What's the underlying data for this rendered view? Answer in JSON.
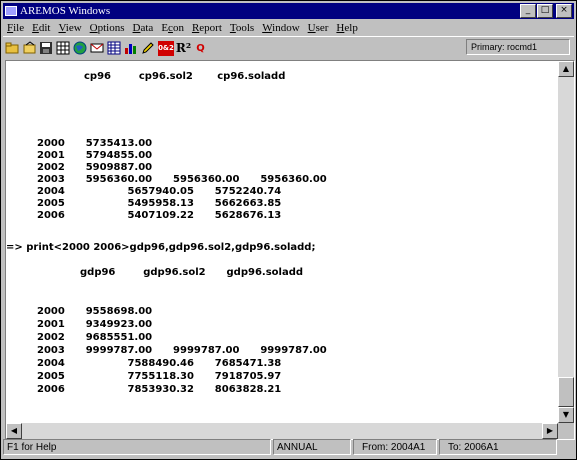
{
  "window": {
    "title": "AREMOS Windows",
    "minimize_glyph": "_",
    "maximize_glyph": "□",
    "close_glyph": "×"
  },
  "menu": [
    "File",
    "Edit",
    "View",
    "Options",
    "Data",
    "Econ",
    "Report",
    "Tools",
    "Window",
    "User",
    "Help"
  ],
  "menu_underlines": [
    "F",
    "E",
    "V",
    "O",
    "D",
    "c",
    "R",
    "T",
    "W",
    "U",
    "H"
  ],
  "toolbar": {
    "tools": [
      "open-folder-icon",
      "open-file-icon",
      "save-icon",
      "table-icon",
      "globe-icon",
      "envelope-icon",
      "grid-icon",
      "bar-chart-icon",
      "pencil-icon",
      "calculator-icon",
      "r-squared-icon",
      "q-icon"
    ],
    "r_squared_label": "R²",
    "q_label": "Q",
    "calc_label": "0&2",
    "primary_label": "Primary: rocmd1"
  },
  "output": {
    "header1": "cp96        cp96.sol2       cp96.soladd",
    "table1": [
      "2000      5735413.00",
      "2001      5794855.00",
      "2002      5909887.00",
      "2003      5956360.00      5956360.00      5956360.00",
      "2004                  5657940.05      5752240.74",
      "2005                  5495958.13      5662663.85",
      "2006                  5407109.22      5628676.13"
    ],
    "command": "=> print<2000 2006>gdp96,gdp96.sol2,gdp96.soladd;",
    "header2": "gdp96        gdp96.sol2      gdp96.soladd",
    "table2": [
      "2000      9558698.00",
      "2001      9349923.00",
      "2002      9685551.00",
      "2003      9999787.00      9999787.00      9999787.00",
      "2004                  7588490.46      7685471.38",
      "2005                  7755118.30      7918705.97",
      "2006                  7853930.32      8063828.21"
    ]
  },
  "status": {
    "help": "F1 for Help",
    "frequency": "ANNUAL",
    "from": "From:  2004A1",
    "to": "To:  2006A1"
  },
  "colors": {
    "titlebar": "#000080",
    "window_bg": "#c0c0c0"
  }
}
